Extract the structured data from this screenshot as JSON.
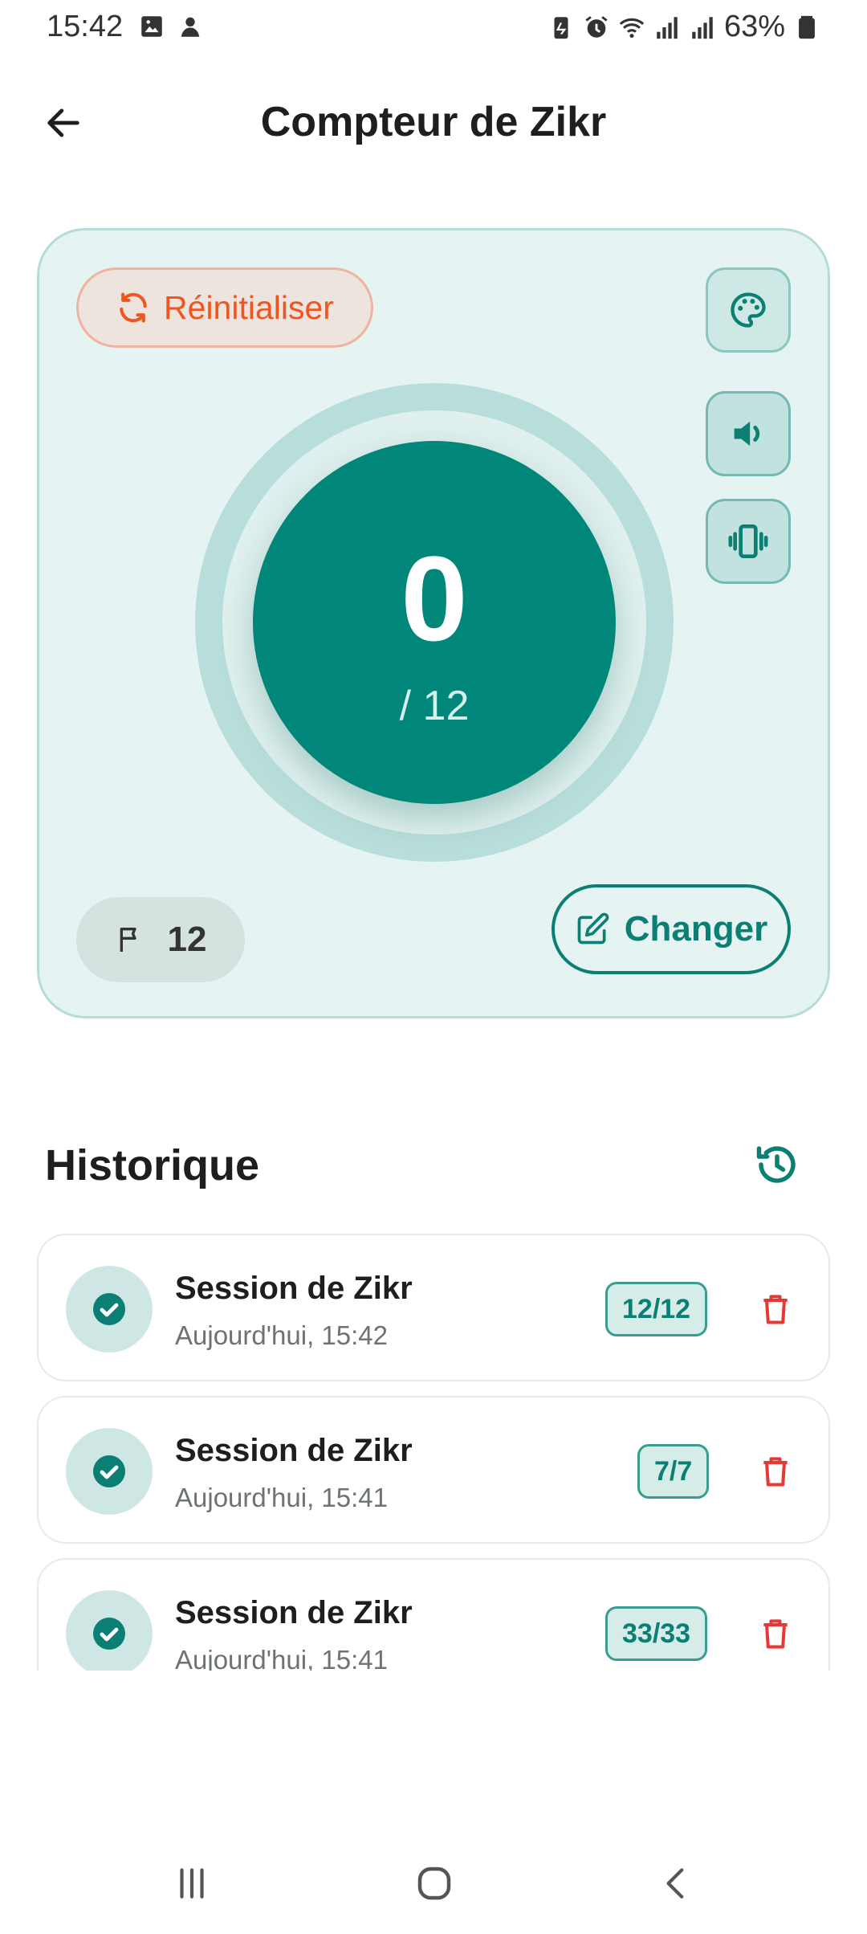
{
  "status_bar": {
    "time": "15:42",
    "battery_percent": "63%",
    "icons_left": [
      "gallery-icon",
      "app-notification-icon"
    ],
    "icons_right": [
      "battery-saver-icon",
      "alarm-icon",
      "wifi-icon",
      "signal-icon",
      "signal-icon",
      "battery-icon"
    ]
  },
  "app_bar": {
    "title": "Compteur de Zikr",
    "back_icon": "arrow-left-icon"
  },
  "counter": {
    "reset_label": "Réinitialiser",
    "count": "0",
    "target_display": "/ 12",
    "target_chip_value": "12",
    "change_label": "Changer",
    "progress_fraction": 0,
    "colors": {
      "primary": "#00877a",
      "accent_red": "#f0551f",
      "card_bg": "#e5f3f2"
    }
  },
  "history": {
    "title": "Historique",
    "items": [
      {
        "title": "Session de Zikr",
        "time": "Aujourd'hui, 15:42",
        "badge": "12/12"
      },
      {
        "title": "Session de Zikr",
        "time": "Aujourd'hui, 15:41",
        "badge": "7/7"
      },
      {
        "title": "Session de Zikr",
        "time": "Aujourd'hui, 15:41",
        "badge": "33/33"
      }
    ]
  },
  "nav_bar": {
    "items": [
      "recent-apps-icon",
      "home-icon",
      "back-icon"
    ]
  }
}
